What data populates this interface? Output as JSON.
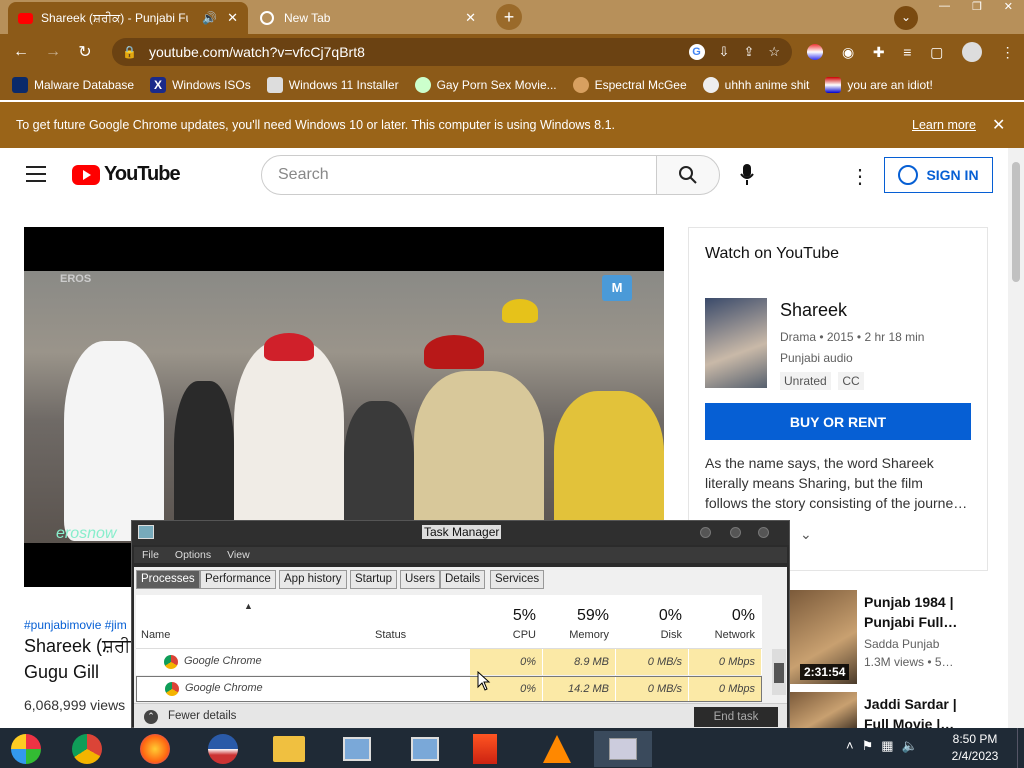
{
  "browser": {
    "tabs": [
      {
        "title": "Shareek (ਸ਼ਰੀਕ) - Punjabi Full",
        "active": true
      },
      {
        "title": "New Tab",
        "active": false
      }
    ],
    "url": "youtube.com/watch?v=vfcCj7qBrt8",
    "bookmarks": [
      "Malware Database",
      "Windows ISOs",
      "Windows 11 Installer",
      "Gay Porn Sex Movie...",
      "Espectral McGee",
      "uhhh anime shit",
      "you are an idiot!"
    ],
    "infobar": {
      "message": "To get future Google Chrome updates, you'll need Windows 10 or later. This computer is using Windows 8.1.",
      "link": "Learn more"
    }
  },
  "youtube": {
    "logo_text": "YouTube",
    "search_placeholder": "Search",
    "signin": "SIGN IN",
    "video": {
      "hashtags": "#punjabimovie #jim",
      "title_line1": "Shareek (ਸ਼ਰੀਕ",
      "title_line2": "Gugu Gill",
      "views": "6,068,999 views",
      "watermark_left": "erosnow",
      "watermark_top": "EROS",
      "logo_badge": "M"
    },
    "side_panel": {
      "heading": "Watch on YouTube",
      "movie_title": "Shareek",
      "meta": "Drama • 2015 • 2 hr 18 min",
      "audio": "Punjabi audio",
      "chips": [
        "Unrated",
        "CC"
      ],
      "buy_button": "BUY OR RENT",
      "description": [
        "As the name says, the word Shareek",
        "literally means Sharing, but the film",
        "follows the story consisting of the journe…"
      ]
    },
    "recommendations": [
      {
        "title1": "Punjab 1984 |",
        "title2": "Punjabi Full…",
        "channel": "Sadda Punjab",
        "meta": "1.3M views  • 5…",
        "duration": "2:31:54"
      },
      {
        "title1": "Jaddi Sardar |",
        "title2": "Full Movie |…",
        "channel": "",
        "meta": "",
        "duration": ""
      }
    ]
  },
  "task_manager": {
    "title": "Task Manager",
    "menu": [
      "File",
      "Options",
      "View"
    ],
    "tabs": [
      "Processes",
      "Performance",
      "App history",
      "Startup",
      "Users",
      "Details",
      "Services"
    ],
    "columns": {
      "name": "Name",
      "status": "Status",
      "cpu": {
        "label": "CPU",
        "pct": "5%"
      },
      "memory": {
        "label": "Memory",
        "pct": "59%"
      },
      "disk": {
        "label": "Disk",
        "pct": "0%"
      },
      "network": {
        "label": "Network",
        "pct": "0%"
      }
    },
    "rows": [
      {
        "name": "Google Chrome",
        "cpu": "0%",
        "memory": "8.9 MB",
        "disk": "0 MB/s",
        "network": "0 Mbps"
      },
      {
        "name": "Google Chrome",
        "cpu": "0%",
        "memory": "14.2 MB",
        "disk": "0 MB/s",
        "network": "0 Mbps"
      }
    ],
    "fewer_details": "Fewer details",
    "end_task": "End task"
  },
  "taskbar": {
    "time": "8:50 PM",
    "date": "2/4/2023"
  },
  "colors": {
    "chrome_frame": "#8c5a18",
    "youtube_red": "#ff0000",
    "link_blue": "#065fd4"
  }
}
